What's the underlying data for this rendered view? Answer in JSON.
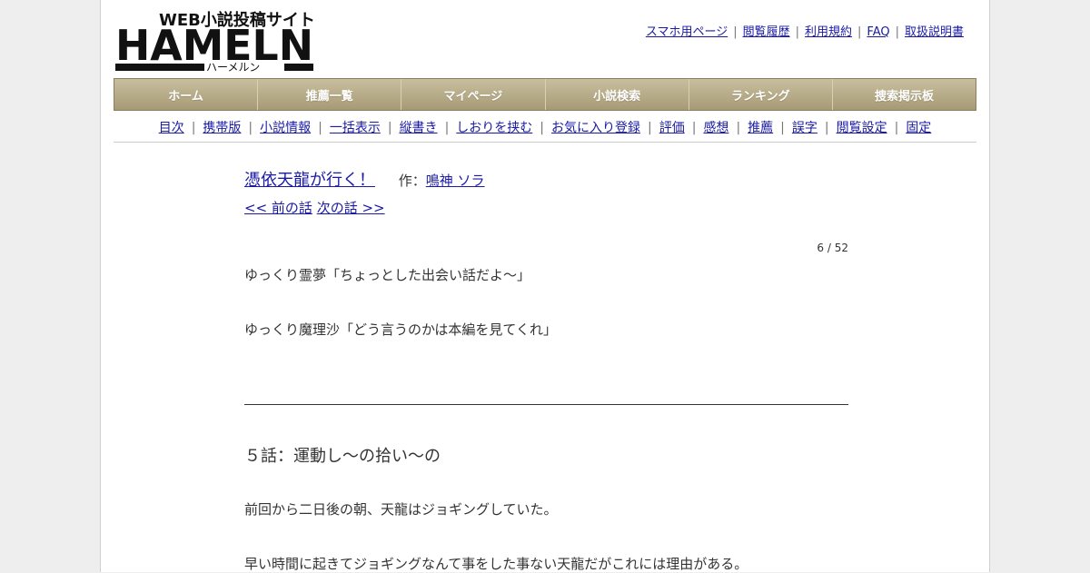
{
  "brand": {
    "logo_text": "HAMELN",
    "tagline": "WEB小説投稿サイト",
    "kana": "ハーメルン"
  },
  "toplinks": [
    {
      "label": "スマホ用ページ"
    },
    {
      "label": "閲覧履歴"
    },
    {
      "label": "利用規約"
    },
    {
      "label": "FAQ"
    },
    {
      "label": "取扱説明書"
    }
  ],
  "mainnav": [
    {
      "label": "ホーム"
    },
    {
      "label": "推薦一覧"
    },
    {
      "label": "マイページ"
    },
    {
      "label": "小説検索"
    },
    {
      "label": "ランキング"
    },
    {
      "label": "捜索掲示板"
    }
  ],
  "subnav": [
    {
      "label": "目次"
    },
    {
      "label": "携帯版"
    },
    {
      "label": "小説情報"
    },
    {
      "label": "一括表示"
    },
    {
      "label": "縦書き"
    },
    {
      "label": "しおりを挟む"
    },
    {
      "label": "お気に入り登録"
    },
    {
      "label": "評価"
    },
    {
      "label": "感想"
    },
    {
      "label": "推薦"
    },
    {
      "label": "誤字"
    },
    {
      "label": "閲覧設定"
    },
    {
      "label": "固定"
    }
  ],
  "novel": {
    "title": "憑依天龍が行く！",
    "author_prefix": "作：",
    "author": "鳴神 ソラ",
    "prev": "<< 前の話",
    "next": "次の話 >>",
    "page_count": "6 / 52",
    "foreword": [
      "ゆっくり霊夢「ちょっとした出会い話だよ～」",
      "ゆっくり魔理沙「どう言うのかは本編を見てくれ」"
    ],
    "chapter_title": "５話：運動し～の拾い～の",
    "body": [
      "前回から二日後の朝、天龍はジョギングしていた。",
      "早い時間に起きてジョギングなんて事をした事ない天龍だがこれには理由がある。"
    ]
  },
  "colors": {
    "link": "#1a1aa6",
    "nav_top": "#c9bf9e",
    "nav_bottom": "#a69a76",
    "background": "#eeeeee"
  }
}
